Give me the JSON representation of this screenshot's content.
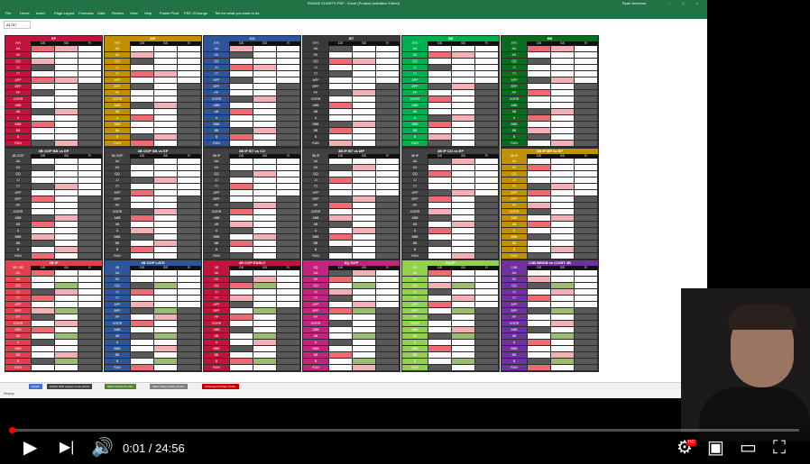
{
  "excel": {
    "doc_title": "RANGE CHARTS PDF - Excel (Product Activation Failed)",
    "user_name": "Ryan Nemirow",
    "window_controls": [
      "–",
      "□",
      "×"
    ],
    "ribbon_tabs": [
      "File",
      "Home",
      "Insert",
      "Page Layout",
      "Formulas",
      "Data",
      "Review",
      "View",
      "Help",
      "Power Pivot",
      "PDF-XChange"
    ],
    "tell_me": "Tell me what you want to do",
    "name_box": "A1757",
    "sheet_tabs": [
      "Hands",
      "9-MAX OR2 ranges to see charts",
      "6Max Preflop PL100+",
      "6Max Video Preflop PL25+",
      "10 Ranges-Preflop PL25+"
    ],
    "sheet_tab_colors": [
      "#4472c4",
      "#404040",
      "#548235",
      "#7f7f7f",
      "#c00000"
    ],
    "status_ready": "Ready",
    "status_zoom": "100%",
    "col_headers": [
      "DS",
      "SS",
      "R"
    ],
    "row_labels": [
      "AA",
      "KK",
      "QQ",
      "JJ",
      "TT",
      "APP",
      "BPP",
      "PP",
      "OORR",
      "ABB",
      "AB",
      "A",
      "BBB",
      "BB",
      "B",
      "RUN"
    ]
  },
  "blocks": [
    {
      "title": "EP",
      "corner": "RFI",
      "color": "#c0143c"
    },
    {
      "title": "MP",
      "corner": "RFI",
      "color": "#bf9000"
    },
    {
      "title": "CO",
      "corner": "RFI",
      "color": "#2e5597"
    },
    {
      "title": "BT",
      "corner": "RFI",
      "color": "#3a3a3a"
    },
    {
      "title": "SB",
      "corner": "RFI",
      "color": "#00b050"
    },
    {
      "title": "BB",
      "corner": "RFI",
      "color": "#0b6b1f"
    },
    {
      "title": "3B OOP BB vs EP",
      "corner": "3B OOP",
      "color": "#404040"
    },
    {
      "title": "3B OOP SB vs EP",
      "corner": "3B OOP",
      "color": "#404040"
    },
    {
      "title": "3B IP BT vs CO",
      "corner": "3B IP",
      "color": "#404040"
    },
    {
      "title": "3B IP BT vs MP",
      "corner": "3B IP",
      "color": "#404040"
    },
    {
      "title": "3B IP CO vs EP",
      "corner": "3B IP",
      "color": "#404040"
    },
    {
      "title": "3B IP MP vs EP",
      "corner": "3B IP",
      "color": "#bf9000"
    },
    {
      "title": "4B IP",
      "corner": "4B / 5B",
      "color": "#e04050"
    },
    {
      "title": "4B OOP LATE",
      "corner": "4B",
      "color": "#2e5597"
    },
    {
      "title": "4B OOP EARLY",
      "corner": "4B",
      "color": "#c0143c"
    },
    {
      "title": "SQ OOP",
      "corner": "SQ",
      "color": "#c0247c"
    },
    {
      "title": "SQ IP",
      "corner": "SQ",
      "color": "#92d050"
    },
    {
      "title": "C4B BB/SB vs CO/BT 3B",
      "corner": "C4B",
      "color": "#7030a0"
    }
  ],
  "player": {
    "time_current": "0:01",
    "time_total": "24:56",
    "progress_fraction": 0.0007,
    "icons": [
      "play-icon",
      "next-icon",
      "volume-icon",
      "settings-icon",
      "miniplayer-icon",
      "theater-icon",
      "fullscreen-icon"
    ],
    "hd_badge": "HD"
  }
}
